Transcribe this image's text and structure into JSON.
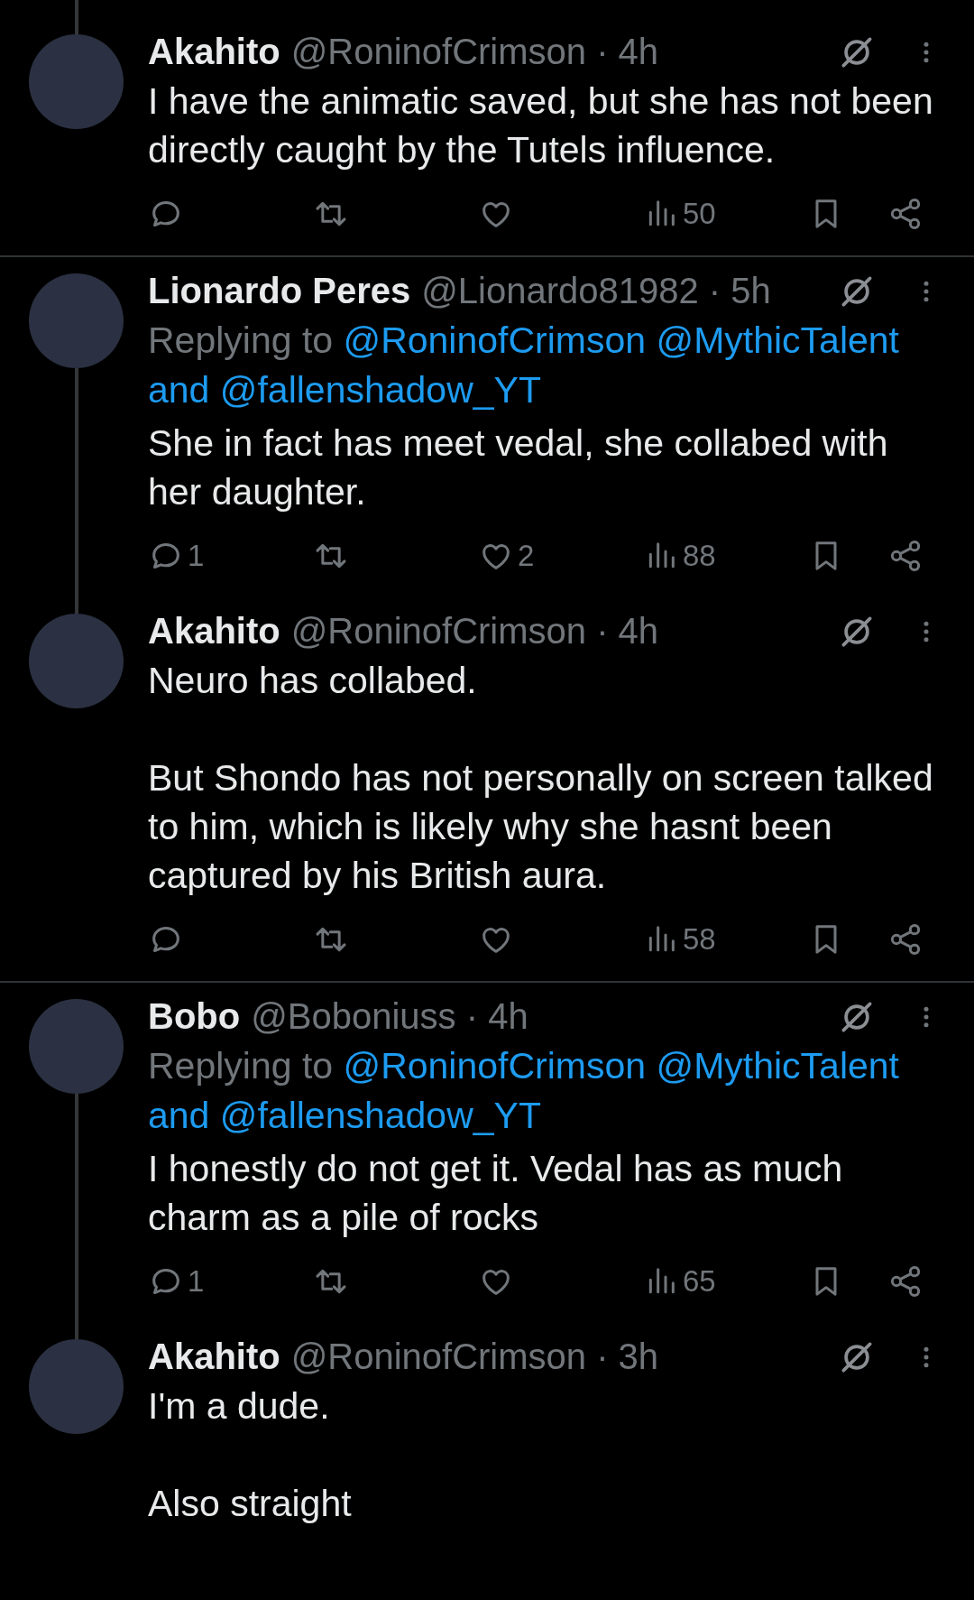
{
  "tweets": [
    {
      "author": "Akahito",
      "handle_time": "@RoninofCrimson · 4h",
      "thread_above": true,
      "thread_below": false,
      "paragraphs": [
        "I have the animatic saved, but she has not been directly caught by the Tutels influence."
      ],
      "actions": {
        "views": "50"
      },
      "divider_below": true
    },
    {
      "author": "Lionardo Peres",
      "handle_time": "@Lionardo81982 · 5h",
      "thread_above": false,
      "thread_below": true,
      "replying": {
        "label": "Replying to",
        "mentions": [
          "@RoninofCrimson",
          "@MythicTalent"
        ],
        "joiner": "and",
        "last": "@fallenshadow_YT"
      },
      "paragraphs": [
        "She in fact has meet vedal, she collabed with her daughter."
      ],
      "actions": {
        "replies": "1",
        "likes": "2",
        "views": "88"
      },
      "divider_below": false
    },
    {
      "author": "Akahito",
      "handle_time": "@RoninofCrimson · 4h",
      "thread_above": true,
      "thread_below": false,
      "paragraphs": [
        "Neuro has collabed.",
        "But Shondo has not personally on screen talked to him, which is likely why she hasnt been captured by his British aura."
      ],
      "actions": {
        "views": "58"
      },
      "divider_below": true
    },
    {
      "author": "Bobo",
      "handle_time": "@Boboniuss · 4h",
      "thread_above": false,
      "thread_below": true,
      "replying": {
        "label": "Replying to",
        "mentions": [
          "@RoninofCrimson",
          "@MythicTalent"
        ],
        "joiner": "and",
        "last": "@fallenshadow_YT"
      },
      "paragraphs": [
        "I honestly do not get it. Vedal has as much charm as a pile of rocks"
      ],
      "actions": {
        "replies": "1",
        "views": "65"
      },
      "divider_below": false
    },
    {
      "author": "Akahito",
      "handle_time": "@RoninofCrimson · 3h",
      "thread_above": true,
      "thread_below": false,
      "paragraphs": [
        "I'm a dude.",
        "Also straight"
      ],
      "divider_below": false
    }
  ]
}
